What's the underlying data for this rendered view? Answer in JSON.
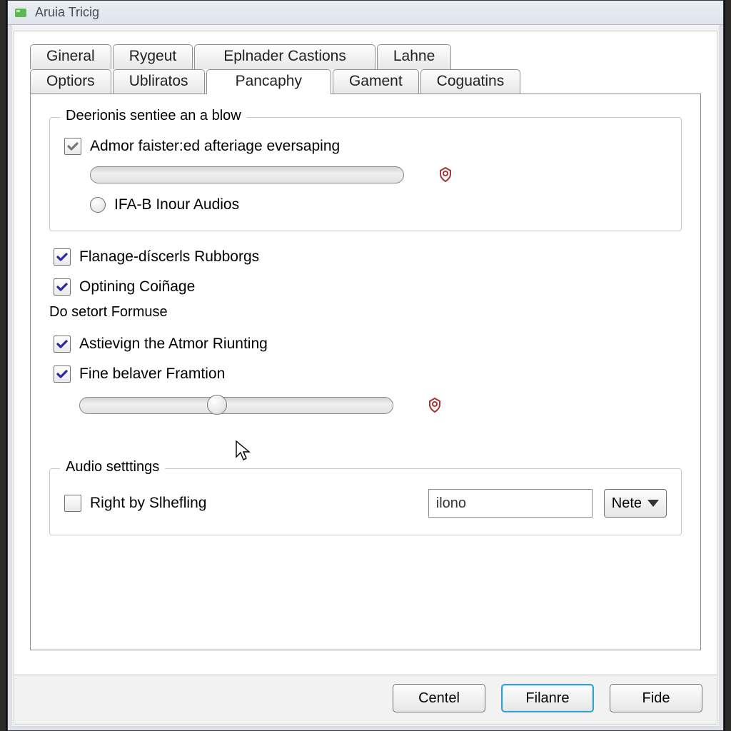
{
  "window": {
    "title": "Aruia Tricig"
  },
  "tabs": {
    "row1": [
      {
        "label": "Gineral"
      },
      {
        "label": "Rygeut"
      },
      {
        "label": "Eplnader Castions"
      },
      {
        "label": "Lahne"
      }
    ],
    "row2": [
      {
        "label": "Optiors"
      },
      {
        "label": "Ubliratos"
      },
      {
        "label": "Pancaphy",
        "active": true
      },
      {
        "label": "Gament"
      },
      {
        "label": "Coguatins"
      }
    ]
  },
  "group1": {
    "legend": "Deerionis sentiee an a blow",
    "check1": {
      "label": "Admor faister:ed afteriage eversaping",
      "checked": true
    },
    "radio1": {
      "label": "IFA-B Inour Audios",
      "selected": false
    }
  },
  "checks_mid": {
    "c1": {
      "label": "Flanage-díscerls Rubborgs",
      "checked": true
    },
    "c2": {
      "label": "Optining Coiñage",
      "checked": true
    }
  },
  "group2": {
    "legend": "Do setort Formuse",
    "c1": {
      "label": "Astievign the Atmor Riunting",
      "checked": true
    },
    "c2": {
      "label": "Fine belaver Framtion",
      "checked": true
    },
    "slider_value": 42
  },
  "group3": {
    "legend": "Audio setttings",
    "c1": {
      "label": "Right by Slhefling",
      "checked": false
    },
    "input_value": "ilono",
    "dropdown_label": "Nete"
  },
  "footer": {
    "cancel": "Centel",
    "ok": "Filanre",
    "apply": "Fide"
  }
}
